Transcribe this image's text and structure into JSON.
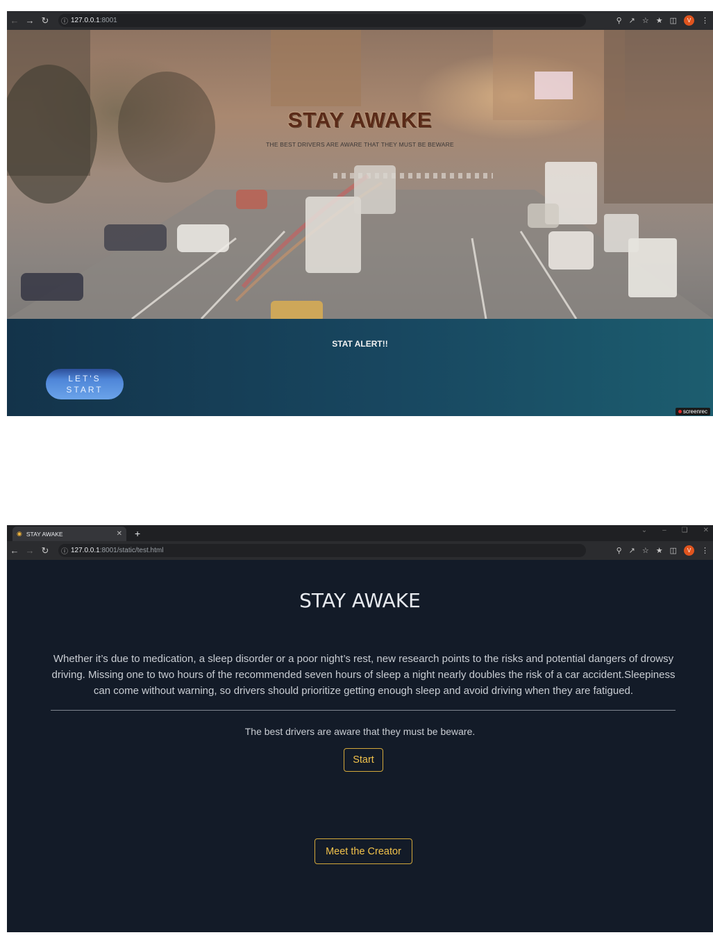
{
  "screen1": {
    "browser": {
      "url_host": "127.0.0.1",
      "url_rest": ":8001"
    },
    "hero": {
      "title": "STAY AWAKE",
      "subtitle": "THE BEST DRIVERS ARE AWARE THAT THEY MUST BE BEWARE"
    },
    "stat": {
      "title": "STAT ALERT!!",
      "button_line1": "LET'S",
      "button_line2": "START"
    },
    "recorder_label": "screenrec"
  },
  "screen2": {
    "browser": {
      "tab_title": "STAY AWAKE",
      "url_host": "127.0.0.1",
      "url_rest": ":8001/static/test.html"
    },
    "page": {
      "title": "STAY AWAKE",
      "paragraph": "Whether it’s due to medication, a sleep disorder or a poor night’s rest, new research points to the risks and potential dangers of drowsy driving. Missing one to two hours of the recommended seven hours of sleep a night nearly doubles the risk of a car accident.Sleepiness can come without warning, so drivers should prioritize getting enough sleep and avoid driving when they are fatigued.",
      "tagline": "The best drivers are aware that they must be beware.",
      "start_label": "Start",
      "creator_label": "Meet the Creator"
    }
  },
  "colors": {
    "page_bg": "#131b28",
    "accent": "#f0c14b",
    "stat_bg": "#184760",
    "lets_button": "#4f86d8"
  }
}
